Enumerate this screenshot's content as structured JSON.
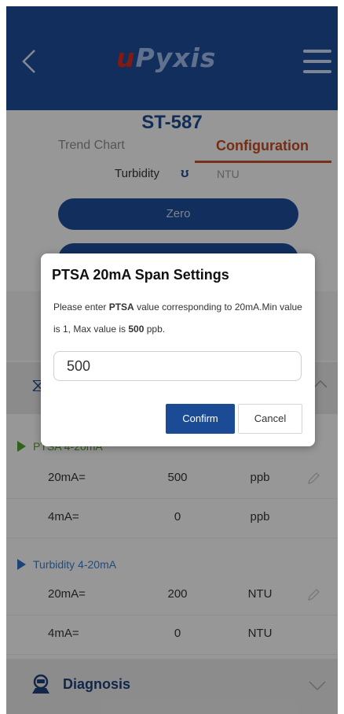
{
  "header": {
    "back_icon": "chevron-left-icon",
    "logo_first": "u",
    "logo_rest": "Pyxis",
    "menu_icon": "hamburger-menu-icon",
    "background_color": "#1c4b96"
  },
  "device": {
    "title": "ST-587"
  },
  "tabs": [
    {
      "label": "Trend Chart",
      "active": false
    },
    {
      "label": "Configuration",
      "active": true
    }
  ],
  "turbidity_toggle": {
    "label": "Turbidity",
    "toggle_glyph": "ʊ",
    "unit": "NTU"
  },
  "buttons": {
    "zero": "Zero"
  },
  "groups": [
    {
      "title": "PTSA 4-20mA",
      "rows": [
        {
          "label": "20mA=",
          "value": "500",
          "unit": "ppb",
          "editable": true
        },
        {
          "label": "4mA=",
          "value": "0",
          "unit": "ppb",
          "editable": false
        }
      ]
    },
    {
      "title": "Turbidity 4-20mA",
      "rows": [
        {
          "label": "20mA=",
          "value": "200",
          "unit": "NTU",
          "editable": true
        },
        {
          "label": "4mA=",
          "value": "0",
          "unit": "NTU",
          "editable": false
        }
      ]
    }
  ],
  "diagnosis": {
    "label": "Diagnosis",
    "icon": "diagnosis-icon"
  },
  "dialog": {
    "title": "PTSA 20mA Span Settings",
    "msg_prefix": "Please enter ",
    "msg_param": "PTSA",
    "msg_middle": "  value corresponding to 20mA.Min value is 1, Max value is ",
    "msg_max": "500",
    "msg_unit": " ppb.",
    "input_value": "500",
    "confirm_label": "Confirm",
    "cancel_label": "Cancel"
  },
  "colors": {
    "primary": "#1c4b96",
    "accent": "#c0502a",
    "ptsa_green": "#4f9d2c",
    "turbidity_blue": "#3a79c5"
  }
}
